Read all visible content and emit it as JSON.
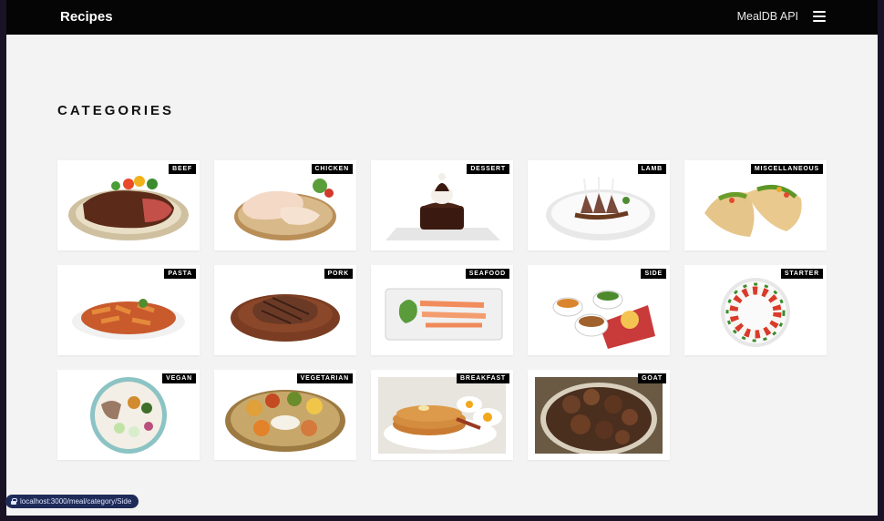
{
  "navbar": {
    "brand": "Recipes",
    "api_link": "MealDB API",
    "menu_icon": "hamburger-icon"
  },
  "page": {
    "section_title": "CATEGORIES"
  },
  "categories": [
    {
      "label": "BEEF",
      "dish": "steak"
    },
    {
      "label": "CHICKEN",
      "dish": "raw chicken"
    },
    {
      "label": "DESSERT",
      "dish": "chocolate cake"
    },
    {
      "label": "LAMB",
      "dish": "lamb rack"
    },
    {
      "label": "MISCELLANEOUS",
      "dish": "tacos"
    },
    {
      "label": "PASTA",
      "dish": "penne"
    },
    {
      "label": "PORK",
      "dish": "pork steak"
    },
    {
      "label": "SEAFOOD",
      "dish": "salmon plate"
    },
    {
      "label": "SIDE",
      "dish": "side bowls"
    },
    {
      "label": "STARTER",
      "dish": "caprese wreath"
    },
    {
      "label": "VEGAN",
      "dish": "vegan bowl"
    },
    {
      "label": "VEGETARIAN",
      "dish": "thali"
    },
    {
      "label": "BREAKFAST",
      "dish": "pancakes"
    },
    {
      "label": "GOAT",
      "dish": "goat stew"
    }
  ],
  "status_bar": {
    "url": "localhost:3000/meal/category/Side"
  }
}
